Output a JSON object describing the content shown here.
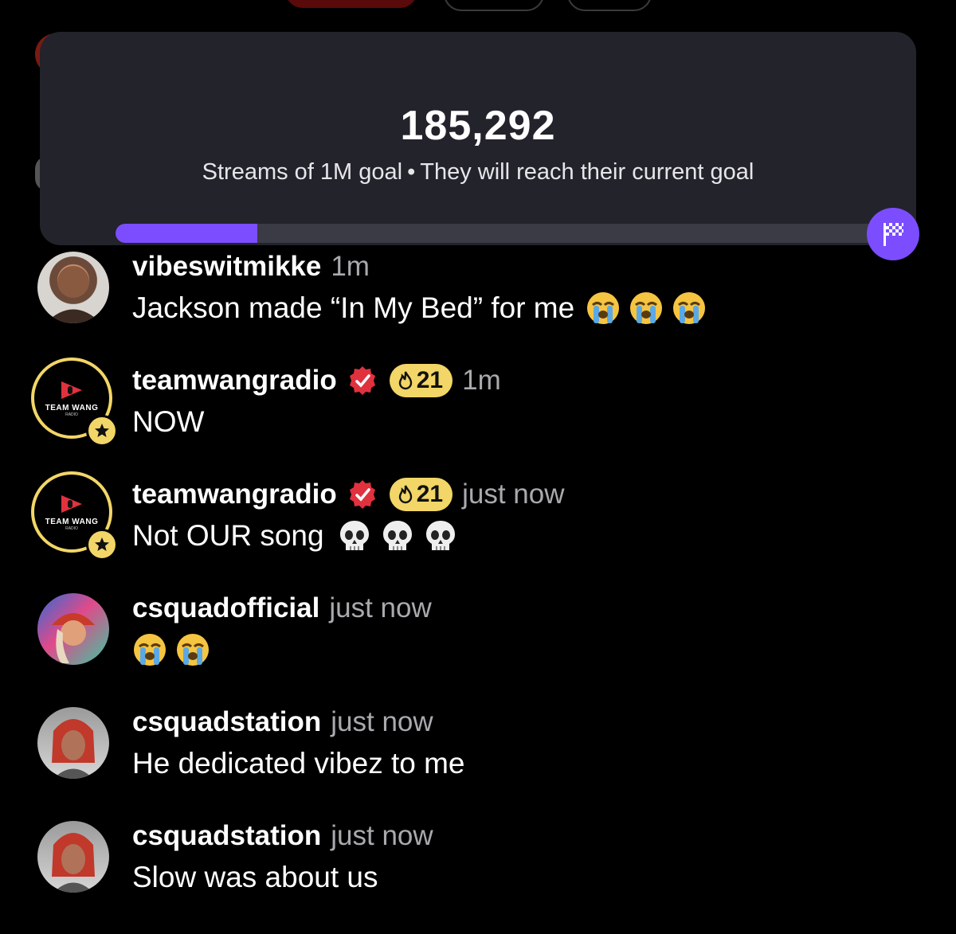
{
  "goal": {
    "count": "185,292",
    "subtitle_left": "Streams of 1M goal",
    "separator": "•",
    "subtitle_right": "They will reach their current goal",
    "progress_fraction": 0.185,
    "accent": "#7c4dff",
    "icon": "checkered-flag-icon"
  },
  "comments": [
    {
      "username": "vibeswitmikke",
      "time": "1m",
      "text": "Jackson made “In My Bed” for me",
      "emojis": [
        "loudly-crying-face",
        "loudly-crying-face",
        "loudly-crying-face"
      ]
    },
    {
      "username": "teamwangradio",
      "time": "1m",
      "fire_count": "21",
      "text": "NOW",
      "avatar_text": "TEAM WANG",
      "avatar_subtext": "RADIO"
    },
    {
      "username": "teamwangradio",
      "time": "just now",
      "fire_count": "21",
      "text": "Not OUR song",
      "avatar_text": "TEAM WANG",
      "avatar_subtext": "RADIO",
      "emojis": [
        "skull",
        "skull",
        "skull"
      ]
    },
    {
      "username": "csquadofficial",
      "time": "just now",
      "text": "",
      "emojis": [
        "loudly-crying-face",
        "loudly-crying-face"
      ]
    },
    {
      "username": "csquadstation",
      "time": "just now",
      "text": "He dedicated vibez to me"
    },
    {
      "username": "csquadstation",
      "time": "just now",
      "text": "Slow was about us"
    }
  ],
  "colors": {
    "background": "#000000",
    "card": "#23232c",
    "badge_yellow": "#f2d667",
    "verified_red": "#e0323e"
  }
}
